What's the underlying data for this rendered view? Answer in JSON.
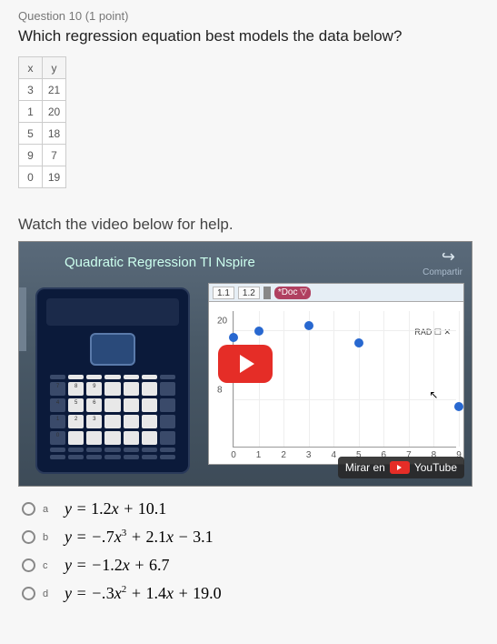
{
  "header": {
    "question_label": "Question 10 (1 point)",
    "title": "Which regression equation best models the data below?"
  },
  "data_table": {
    "columns": [
      "x",
      "y"
    ],
    "rows": [
      [
        3,
        21
      ],
      [
        1,
        20
      ],
      [
        5,
        18
      ],
      [
        9,
        7
      ],
      [
        0,
        19
      ]
    ]
  },
  "video": {
    "heading": "Watch the video below for help.",
    "title": "Quadratic Regression TI Nspire",
    "share_label": "Compartir",
    "toolbar": {
      "tab1": "1.1",
      "tab2": "1.2",
      "doc": "*Doc ▽",
      "mode": "RAD"
    },
    "watch_label": "Mirar en",
    "watch_target": "YouTube"
  },
  "chart_data": {
    "type": "scatter",
    "title": "",
    "xlabel": "",
    "ylabel": "",
    "xlim": [
      0,
      9
    ],
    "ylim": [
      0,
      24
    ],
    "xticks": [
      0,
      1,
      2,
      3,
      4,
      5,
      6,
      7,
      8,
      9
    ],
    "yticks": [
      8,
      20
    ],
    "points": [
      {
        "x": 0,
        "y": 19
      },
      {
        "x": 1,
        "y": 20
      },
      {
        "x": 3,
        "y": 21
      },
      {
        "x": 5,
        "y": 18
      },
      {
        "x": 9,
        "y": 7
      }
    ]
  },
  "options": [
    {
      "label": "a",
      "text_html": "y = <span class='num'>1.2</span>x + <span class='num'>10.1</span>"
    },
    {
      "label": "b",
      "text_html": "y = −.<span class='num'>7</span>x<sup>3</sup> + <span class='num'>2.1</span>x − <span class='num'>3.1</span>"
    },
    {
      "label": "c",
      "text_html": "y = −<span class='num'>1.2</span>x + <span class='num'>6.7</span>"
    },
    {
      "label": "d",
      "text_html": "y = −.<span class='num'>3</span>x<sup>2</sup> + <span class='num'>1.4</span>x + <span class='num'>19.0</span>"
    }
  ]
}
